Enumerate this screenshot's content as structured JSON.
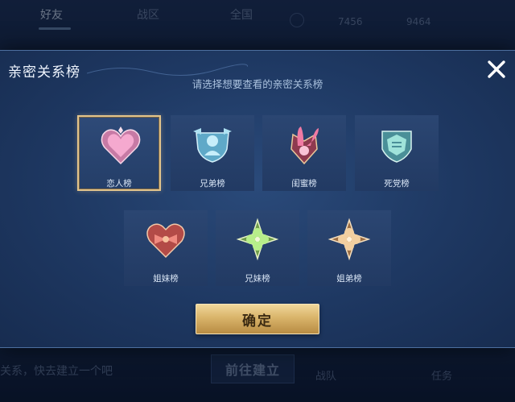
{
  "background": {
    "tabs": [
      "好友",
      "战区",
      "全国"
    ],
    "stats": [
      "7456",
      "9464"
    ],
    "hint_text": "关系，快去建立一个吧",
    "goto_button": "前往建立",
    "bottom_labels": [
      "战队",
      "任务"
    ]
  },
  "dialog": {
    "title": "亲密关系榜",
    "subtitle": "请选择想要查看的亲密关系榜",
    "close_icon": "close-icon",
    "cards": [
      {
        "label": "恋人榜",
        "icon": "heart-emblem-icon",
        "color": "#f29bc7",
        "selected": true
      },
      {
        "label": "兄弟榜",
        "icon": "brothers-emblem-icon",
        "color": "#8fd3ea",
        "selected": false
      },
      {
        "label": "闺蜜榜",
        "icon": "bunny-emblem-icon",
        "color": "#f07aa3",
        "selected": false
      },
      {
        "label": "死党榜",
        "icon": "fist-emblem-icon",
        "color": "#7fd6cf",
        "selected": false
      },
      {
        "label": "姐妹榜",
        "icon": "bow-emblem-icon",
        "color": "#e0685f",
        "selected": false
      },
      {
        "label": "兄妹榜",
        "icon": "clover-emblem-icon",
        "color": "#9fe07c",
        "selected": false
      },
      {
        "label": "姐弟榜",
        "icon": "flower-emblem-icon",
        "color": "#f2cfa0",
        "selected": false
      }
    ],
    "confirm_label": "确定"
  },
  "colors": {
    "accent_gold": "#e2c48c",
    "panel_blue": "#1e3862"
  }
}
